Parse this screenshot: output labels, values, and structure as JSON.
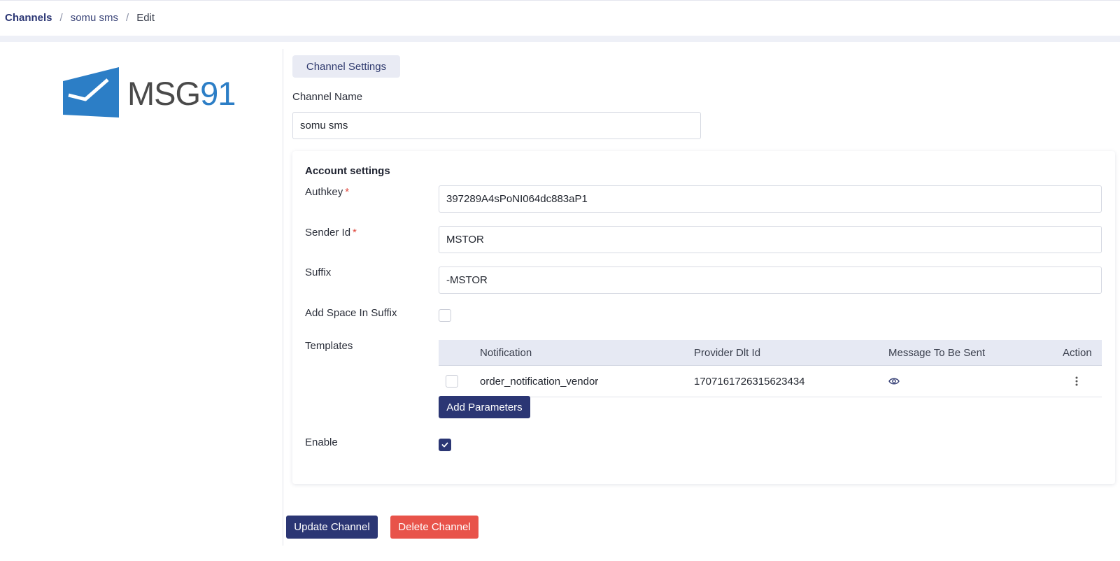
{
  "breadcrumb": {
    "root": "Channels",
    "channel": "somu sms",
    "current": "Edit",
    "separator": "/"
  },
  "logo": {
    "text_main": "MSG",
    "text_num": "91",
    "brand_color": "#2c7ec6"
  },
  "tabs": {
    "channel_settings": "Channel Settings"
  },
  "channel_name": {
    "label": "Channel Name",
    "value": "somu sms"
  },
  "account": {
    "title": "Account settings",
    "authkey": {
      "label": "Authkey",
      "required": "*",
      "value": "397289A4sPoNI064dc883aP1"
    },
    "sender_id": {
      "label": "Sender Id",
      "required": "*",
      "value": "MSTOR"
    },
    "suffix": {
      "label": "Suffix",
      "value": "-MSTOR"
    },
    "add_space": {
      "label": "Add Space In Suffix",
      "checked": false
    },
    "templates": {
      "label": "Templates",
      "columns": [
        "Notification",
        "Provider Dlt Id",
        "Message To Be Sent",
        "Action"
      ],
      "rows": [
        {
          "notification": "order_notification_vendor",
          "provider_dlt_id": "1707161726315623434",
          "message_icon": "eye-icon",
          "action_icon": "kebab-menu-icon"
        }
      ],
      "add_parameters": "Add Parameters"
    },
    "enable": {
      "label": "Enable",
      "checked": true
    }
  },
  "actions": {
    "update": "Update Channel",
    "delete": "Delete Channel"
  },
  "colors": {
    "primary": "#2b3674",
    "danger": "#e8534a",
    "band": "#eef0f7"
  }
}
